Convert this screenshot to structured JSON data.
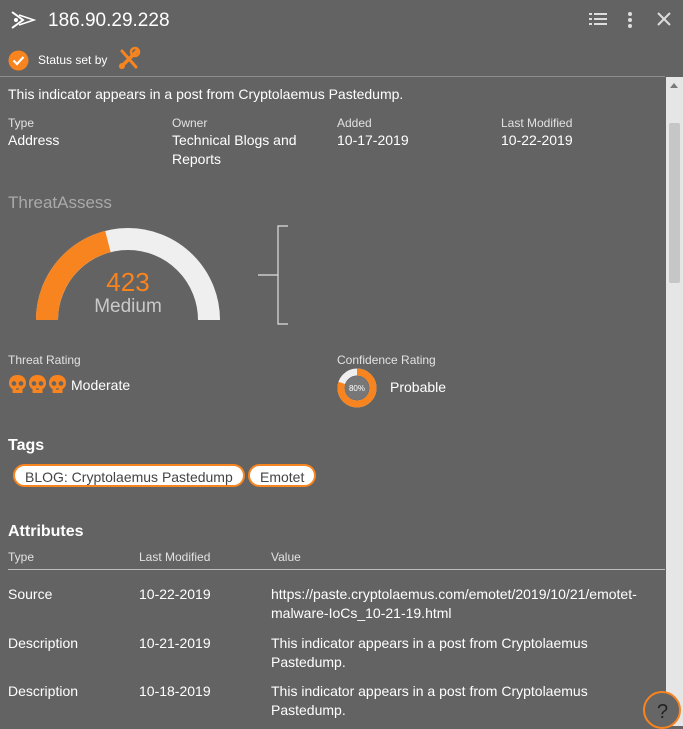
{
  "header": {
    "title": "186.90.29.228",
    "icons": [
      "threatconnect-logo-icon",
      "list-icon",
      "more-vert-icon",
      "close-icon"
    ]
  },
  "status": {
    "label": "Status set by",
    "icon": "check-circle-icon",
    "tool_icon": "tool-logo-icon"
  },
  "description": "This indicator appears in a post from Cryptolaemus Pastedump.",
  "meta": [
    {
      "label": "Type",
      "value": "Address"
    },
    {
      "label": "Owner",
      "value": "Technical Blogs and Reports"
    },
    {
      "label": "Added",
      "value": "10-17-2019"
    },
    {
      "label": "Last Modified",
      "value": "10-22-2019"
    }
  ],
  "threat_assess": {
    "title": "ThreatAssess",
    "score": "423",
    "level": "Medium",
    "gauge_fraction": 0.42,
    "colors": {
      "accent": "#f7841f",
      "track": "#efefef"
    }
  },
  "threat_rating": {
    "label": "Threat Rating",
    "value": "Moderate",
    "skulls": 3,
    "icon": "skull-icon"
  },
  "confidence_rating": {
    "label": "Confidence Rating",
    "value": "Probable",
    "percent_label": "80%",
    "fraction": 0.8
  },
  "tags": {
    "title": "Tags",
    "items": [
      "BLOG: Cryptolaemus Pastedump",
      "Emotet"
    ]
  },
  "attributes": {
    "title": "Attributes",
    "columns": [
      "Type",
      "Last Modified",
      "Value"
    ],
    "rows": [
      {
        "type": "Source",
        "modified": "10-22-2019",
        "value_line1": "https://paste.cryptolaemus.com/emotet/2019/10/21/emotet-",
        "value_line2": "malware-IoCs_10-21-19.html"
      },
      {
        "type": "Description",
        "modified": "10-21-2019",
        "value_line1": "This indicator appears in a post from Cryptolaemus",
        "value_line2": "Pastedump."
      },
      {
        "type": "Description",
        "modified": "10-18-2019",
        "value_line1": "This indicator appears in a post from Cryptolaemus",
        "value_line2": "Pastedump."
      }
    ]
  },
  "help": {
    "label": "?"
  }
}
